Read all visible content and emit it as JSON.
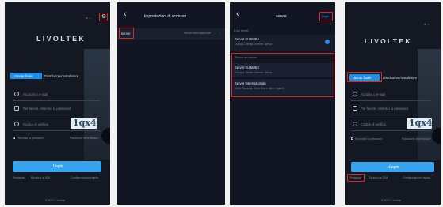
{
  "panel1": {
    "status_icons": "⊕ ☼",
    "logo": "LIVOLTEK",
    "tab_end_user": "Utente finale",
    "tab_installer": "Distributore/Installatore",
    "account_placeholder": "Account o e-mail",
    "password_placeholder": "Per favore, inserisci la password",
    "code_placeholder": "Codice di verifica",
    "captcha": "1qx4",
    "remember": "Ricordati la password",
    "forgot": "Password dimenticata?",
    "login": "Login",
    "footer_register": "Registrati",
    "footer_sim": "Ricarica la SIM",
    "footer_quick": "Configurazione rapida",
    "footer_bottom": "© 2023 Livoltek"
  },
  "panel2": {
    "title": "Impostazioni di accesso",
    "back": "‹",
    "row_label": "server",
    "row_value": "Server internazionale"
  },
  "panel3": {
    "back": "‹",
    "title": "server",
    "login_link": "Login",
    "section_current": "Il tuo server",
    "current_name": "Server EU&MEA",
    "current_desc": "Europa, Medio Oriente, Africa",
    "section_other": "Elenco dei server",
    "opt1_name": "Server EU&MEA",
    "opt1_desc": "Europa, Medio Oriente, Africa",
    "opt2_name": "Server Internazionale",
    "opt2_desc": "Asia, Oceania, Americhe e altre regioni"
  },
  "panel4": {
    "status_icons": "⊕ ☼",
    "logo": "LIVOLTEK",
    "tab_end_user": "Utente finale",
    "tab_installer": "Distributore/Installatore",
    "account_placeholder": "Account o e-mail",
    "password_placeholder": "Per favore, inserisci la password",
    "code_placeholder": "Codice di verifica",
    "captcha": "1qx4",
    "remember": "Ricordati la password",
    "forgot": "Password dimenticata?",
    "login": "Login",
    "footer_register": "Registrati",
    "footer_sim": "Ricarica la SIM",
    "footer_quick": "Configurazione rapida",
    "footer_bottom": "© 2023 Livoltek"
  },
  "colors": {
    "highlight": "#e32222",
    "accent": "#1f8ee8",
    "button": "#38a4ee",
    "background": "#141823"
  }
}
